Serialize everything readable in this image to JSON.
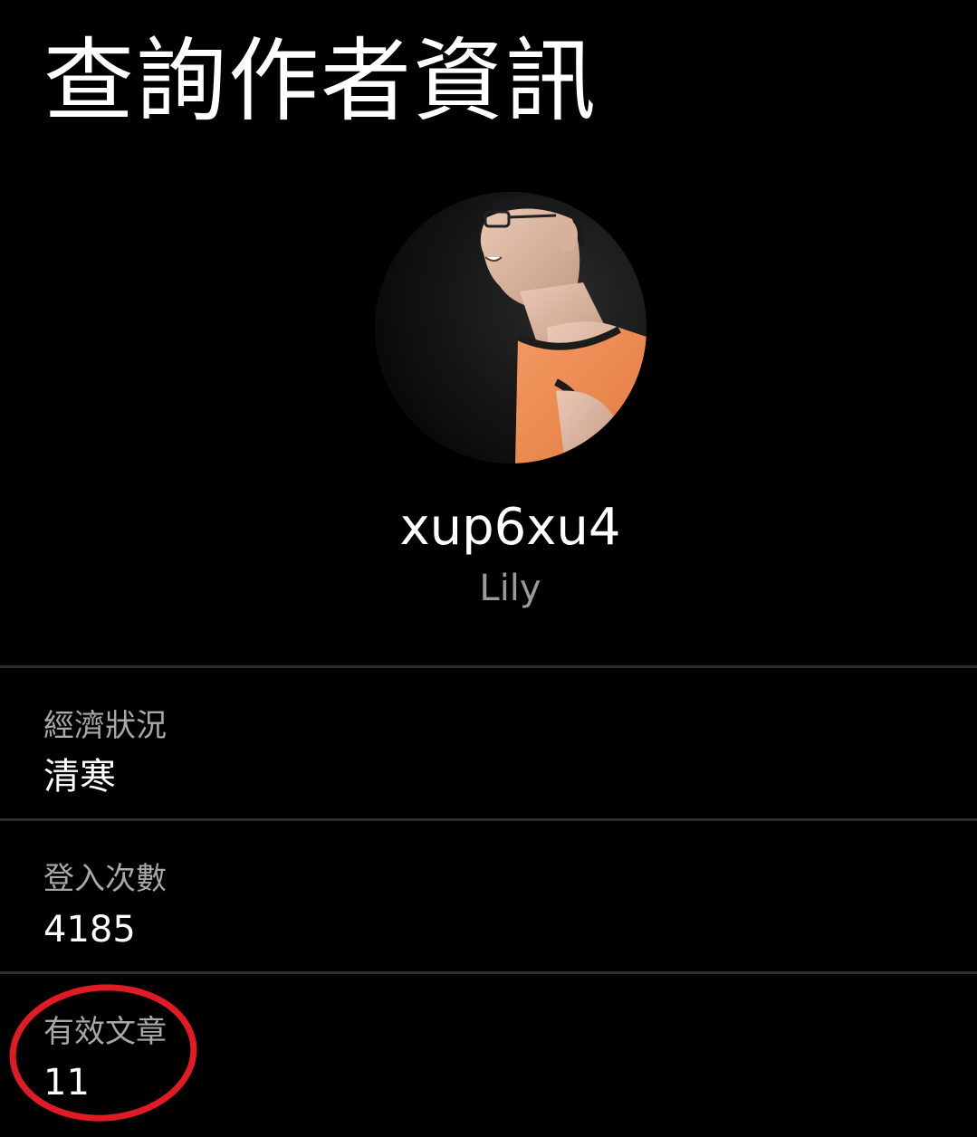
{
  "header": {
    "title": "查詢作者資訊"
  },
  "profile": {
    "username": "xup6xu4",
    "nickname": "Lily",
    "avatar_icon": "profile-photo"
  },
  "info": [
    {
      "label": "經濟狀況",
      "value": "清寒"
    },
    {
      "label": "登入次數",
      "value": "4185"
    },
    {
      "label": "有效文章",
      "value": "11"
    }
  ],
  "colors": {
    "background": "#000000",
    "text_primary": "#ffffff",
    "text_secondary": "#9a9a9a",
    "divider": "#2e2e2e",
    "annotation": "#e01b24"
  }
}
